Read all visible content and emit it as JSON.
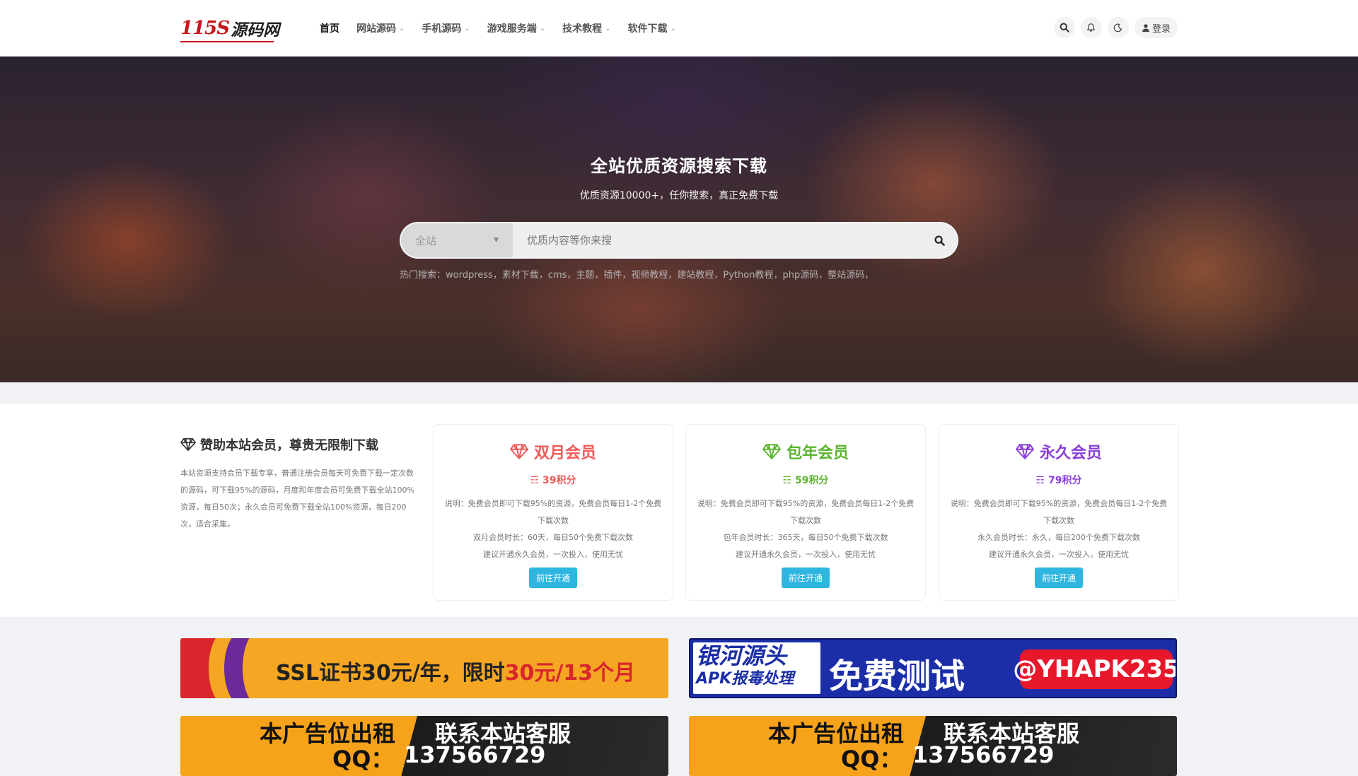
{
  "header": {
    "logo_number": "115S",
    "logo_text": "源码网",
    "nav": [
      {
        "label": "首页",
        "dropdown": false
      },
      {
        "label": "网站源码",
        "dropdown": true
      },
      {
        "label": "手机源码",
        "dropdown": true
      },
      {
        "label": "游戏服务端",
        "dropdown": true
      },
      {
        "label": "技术教程",
        "dropdown": true
      },
      {
        "label": "软件下载",
        "dropdown": true
      }
    ],
    "login_label": "登录",
    "icons": [
      "search-icon",
      "bell-icon",
      "moon-icon",
      "user-icon"
    ]
  },
  "hero": {
    "title": "全站优质资源搜索下载",
    "subtitle": "优质资源10000+，任你搜索，真正免费下载",
    "search_category": "全站",
    "search_placeholder": "优质内容等你来搜",
    "hot_search": "热门搜索：wordpress，素材下载，cms，主题，插件，视频教程，建站教程，Python教程，php源码，整站源码，"
  },
  "vip": {
    "title": "赞助本站会员，尊贵无限制下载",
    "intro": "本站资源支持会员下载专享，普通注册会员每天可免费下载一定次数的源码，可下载95%的源码，月度和年度会员可免费下载全站100%资源，每日50次；永久会员可免费下载全站100%资源，每日200次，适合采集。",
    "cards": [
      {
        "name": "双月会员",
        "price": "39积分",
        "color": "#f05a5a",
        "desc1": "说明：免费会员即可下载95%的资源，免费会员每日1-2个免费下载次数",
        "desc2": "双月会员时长：60天，每日50个免费下载次数",
        "desc3": "建议开通永久会员，一次投入，使用无忧",
        "button": "前往开通"
      },
      {
        "name": "包年会员",
        "price": "59积分",
        "color": "#5cb531",
        "desc1": "说明：免费会员即可下载95%的资源，免费会员每日1-2个免费下载次数",
        "desc2": "包年会员时长：365天，每日50个免费下载次数",
        "desc3": "建议开通永久会员，一次投入，使用无忧",
        "button": "前往开通"
      },
      {
        "name": "永久会员",
        "price": "79积分",
        "color": "#8a3fd8",
        "desc1": "说明：免费会员即可下载95%的资源，免费会员每日1-2个免费下载次数",
        "desc2": "永久会员时长：永久，每日200个免费下载次数",
        "desc3": "建议开通永久会员，一次投入，使用无忧",
        "button": "前往开通"
      }
    ]
  },
  "ads": {
    "ssl_text": "SSL证书30元/年，限时",
    "ssl_highlight": "30元/13个月",
    "galaxy_left1": "银河源头",
    "galaxy_left2": "APK报毒处理",
    "galaxy_mid": "免费测试",
    "galaxy_tag": "@YHAPK235",
    "rent_title": "本广告位出租",
    "rent_contact": "联系本站客服",
    "rent_qq_label": "QQ：",
    "rent_qq": "137566729"
  }
}
